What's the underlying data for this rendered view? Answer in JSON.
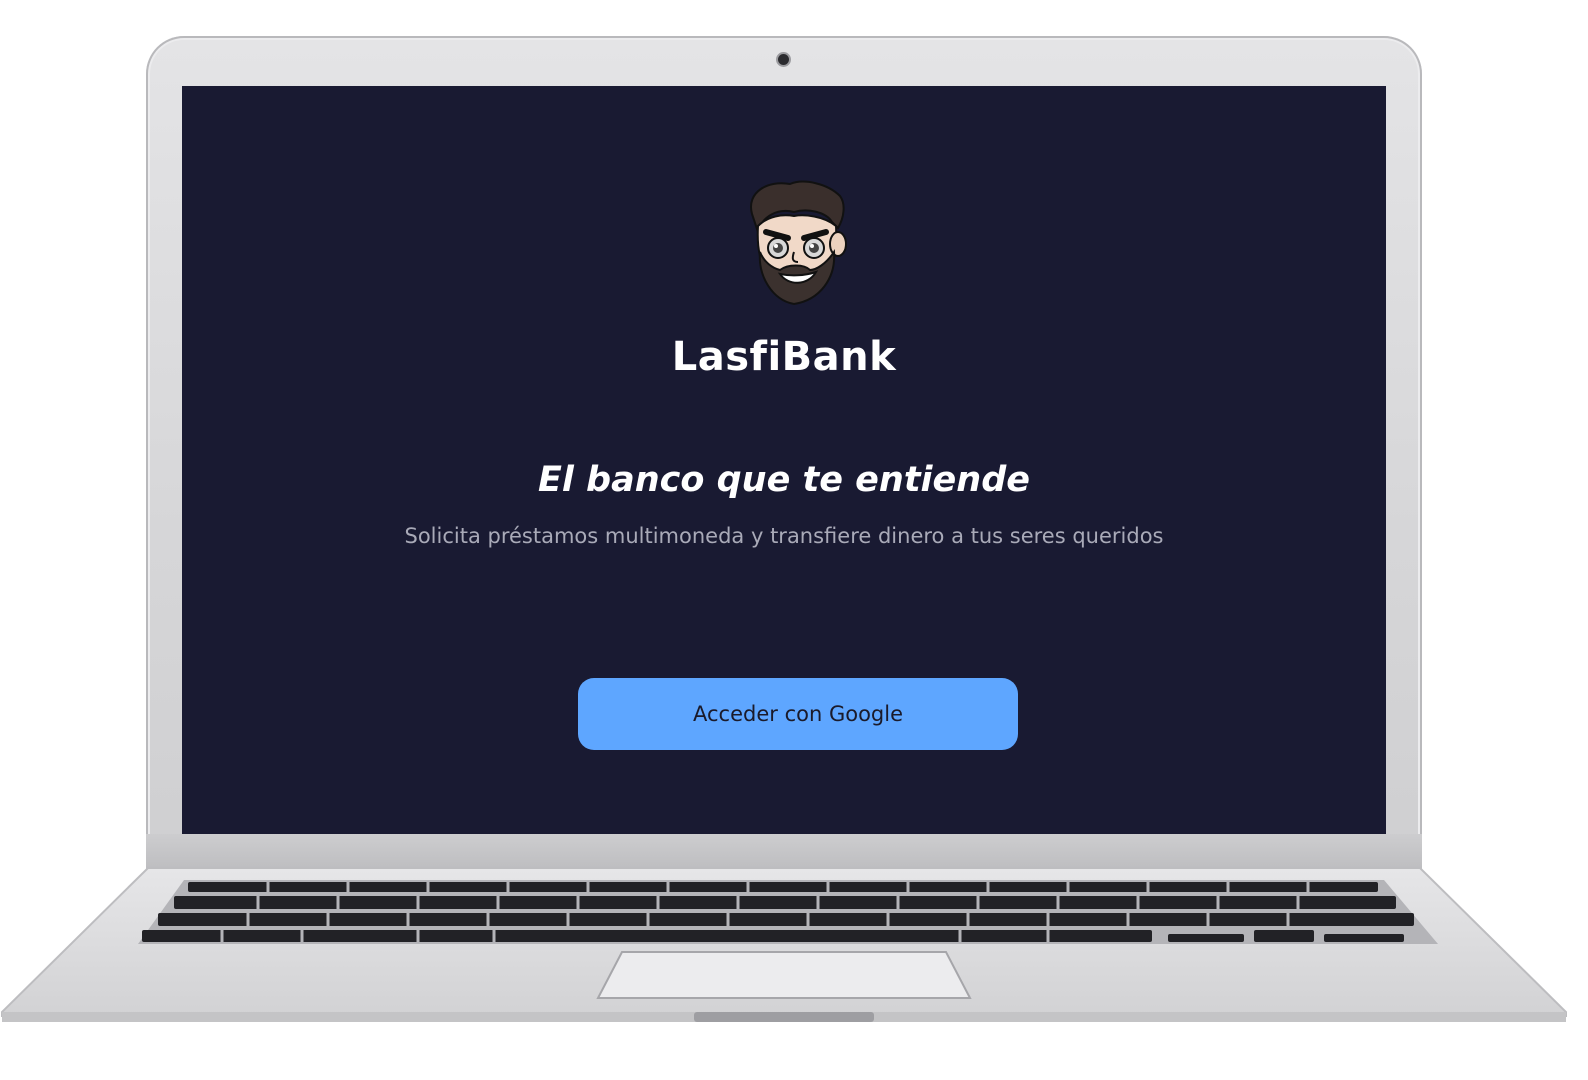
{
  "app": {
    "brand_name": "LasfiBank",
    "tagline": "El banco que te entiende",
    "subtitle": "Solicita préstamos multimoneda y transfiere dinero a tus seres queridos",
    "login_button_label": "Acceder con Google"
  },
  "icons": {
    "mascot": "bearded-man-mascot-icon",
    "camera": "webcam-icon"
  },
  "colors": {
    "screen_background": "#191a32",
    "button_background": "#5ea6ff",
    "text_primary": "#ffffff",
    "text_secondary": "#a9aab8"
  }
}
